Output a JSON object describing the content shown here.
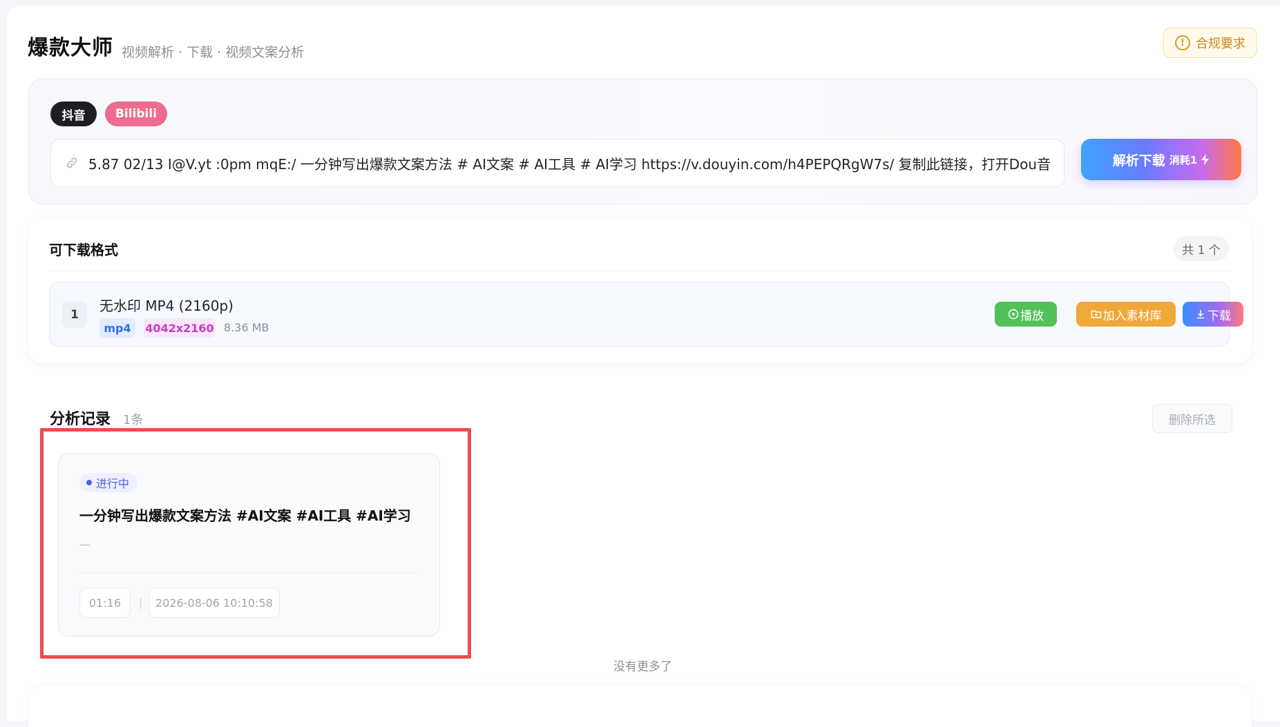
{
  "header": {
    "brand": "爆款大师",
    "subtitle": "视频解析 · 下载 · 视频文案分析",
    "compliance_label": "合规要求"
  },
  "platforms": [
    {
      "label": "抖音",
      "color": "#1d1f24"
    },
    {
      "label": "Bilibili",
      "color": "#f06b90"
    }
  ],
  "input": {
    "value": "5.87 02/13 I@V.yt :0pm mqE:/ 一分钟写出爆款文案方法 # AI文案 # AI工具 # AI学习  https://v.douyin.com/h4PEPQRgW7s/ 复制此链接，打开Dou音"
  },
  "parse_button": {
    "label": "解析下载",
    "cost": "消耗1"
  },
  "formats": {
    "title": "可下载格式",
    "count": "共 1 个",
    "items": [
      {
        "index": "1",
        "name": "无水印 MP4 (2160p)",
        "ext": "mp4",
        "resolution": "4042x2160",
        "size": "8.36 MB",
        "play_label": "播放",
        "add_label": "加入素材库",
        "download_label": "下载"
      }
    ]
  },
  "records": {
    "title": "分析记录",
    "count": "1条",
    "delete_label": "删除所选",
    "items": [
      {
        "status": "进行中",
        "title": "一分钟写出爆款文案方法 #AI文案 #AI工具 #AI学习",
        "desc": "—",
        "duration": "01:16",
        "time": "2026-08-06 10:10:58"
      }
    ],
    "footer": "没有更多了"
  },
  "colors": {
    "accent_play": "#52c15a",
    "accent_add": "#f0a83a",
    "highlight": "#ef4b52",
    "status": "#5560e0"
  }
}
